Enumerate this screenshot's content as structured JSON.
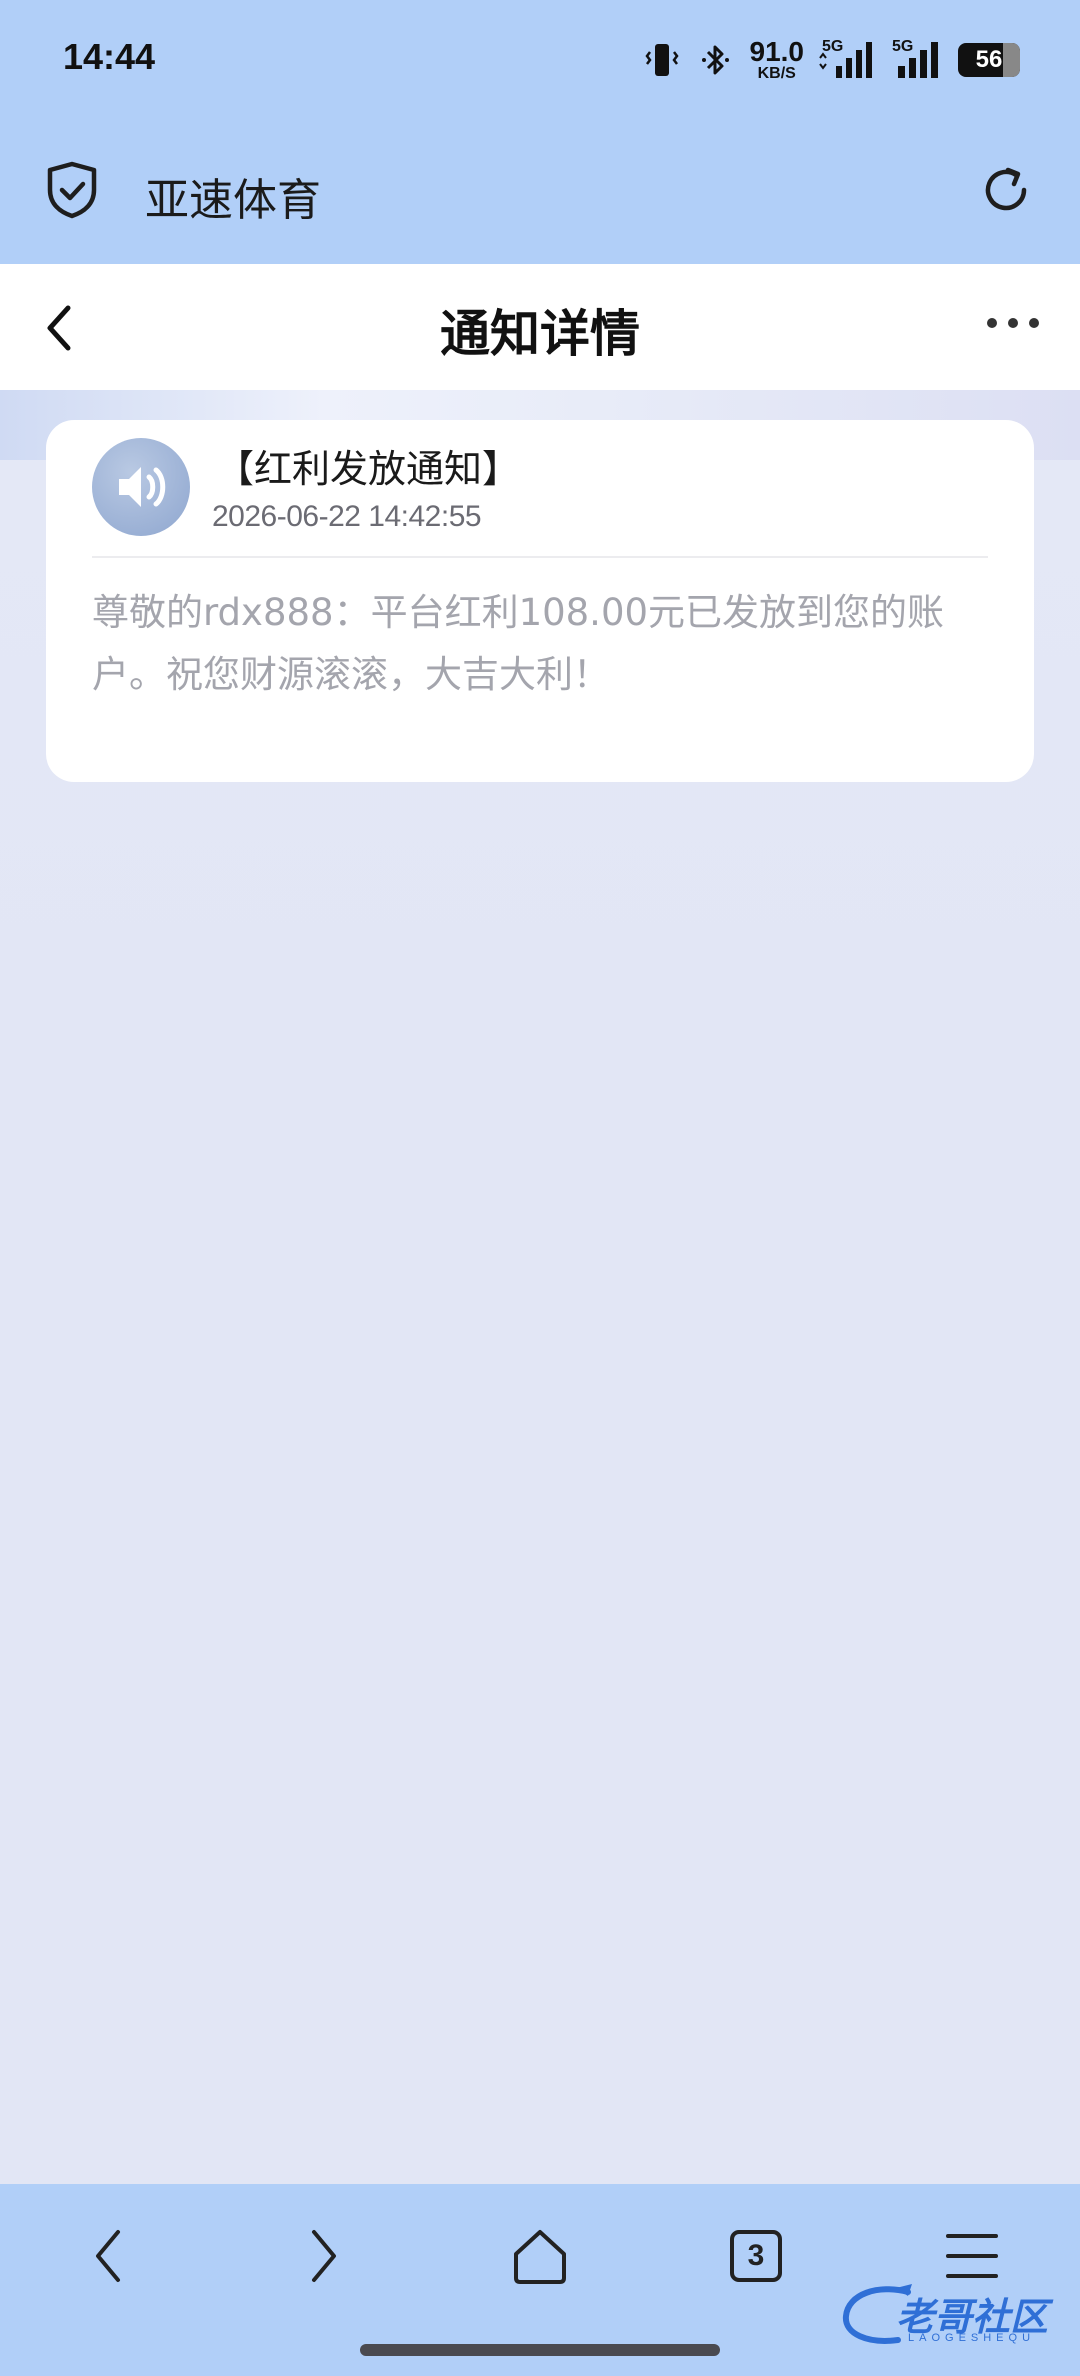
{
  "status_bar": {
    "time": "14:44",
    "net_speed_value": "91.0",
    "net_speed_unit": "KB/S",
    "signal1_label": "5G",
    "signal2_label": "5G",
    "battery_level": "56"
  },
  "browser": {
    "site_title": "亚速体育",
    "icons": [
      "shield-check-icon",
      "refresh-icon"
    ]
  },
  "page": {
    "title": "通知详情"
  },
  "notification": {
    "title": "【红利发放通知】",
    "time": "2026-06-22 14:42:55",
    "body": "尊敬的rdx888：平台红利108.00元已发放到您的账户。祝您财源滚滚，大吉大利！"
  },
  "toolbar": {
    "tab_count": "3",
    "icons": [
      "back-icon",
      "forward-icon",
      "home-icon",
      "tabs-icon",
      "menu-icon"
    ]
  },
  "watermark": {
    "text": "老哥社区",
    "subtext": "LAOGESHEQU"
  },
  "colors": {
    "header_bg": "#b1cff8",
    "page_bg": "#e2e6f5",
    "card_bg": "#ffffff",
    "body_text": "#a4a5ad"
  }
}
